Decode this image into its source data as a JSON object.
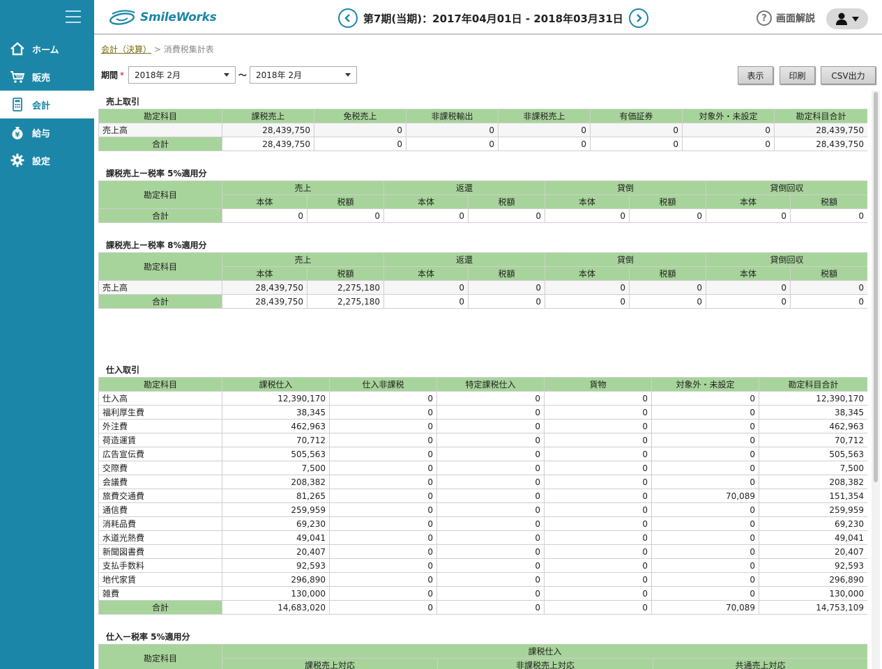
{
  "brand": {
    "name": "SmileWorks",
    "accent": "#1b86a8",
    "header_green": "#a7d49a"
  },
  "nav": [
    {
      "label": "ホーム",
      "icon": "home-icon"
    },
    {
      "label": "販売",
      "icon": "cart-icon"
    },
    {
      "label": "会計",
      "icon": "calculator-icon",
      "active": true
    },
    {
      "label": "給与",
      "icon": "moneybag-icon"
    },
    {
      "label": "設定",
      "icon": "gear-icon"
    }
  ],
  "header": {
    "period": "第7期(当期)：2017年04月01日 - 2018年03月31日",
    "help": "画面解説"
  },
  "breadcrumb": {
    "parent": "会計（決算）",
    "sep": " > ",
    "current": "消費税集計表"
  },
  "filter": {
    "label": "期間",
    "required": "*",
    "from": "2018年 2月",
    "tilde": "〜",
    "to": "2018年 2月"
  },
  "toolbar": {
    "show": "表示",
    "print": "印刷",
    "csv": "CSV出力"
  },
  "sales": {
    "title": "売上取引",
    "headers": [
      "勘定科目",
      "課税売上",
      "免税売上",
      "非課税輸出",
      "非課税売上",
      "有価証券",
      "対象外・未設定",
      "勘定科目合計"
    ],
    "rows": [
      [
        "売上高",
        "28,439,750",
        "0",
        "0",
        "0",
        "0",
        "0",
        "28,439,750"
      ]
    ],
    "total": [
      "合計",
      "28,439,750",
      "0",
      "0",
      "0",
      "0",
      "0",
      "28,439,750"
    ]
  },
  "sales5": {
    "title": "課税売上ー税率 5%適用分",
    "col0": "勘定科目",
    "groups": [
      "売上",
      "返還",
      "貸倒",
      "貸倒回収"
    ],
    "sub": [
      "本体",
      "税額"
    ],
    "rows": [],
    "total": [
      "合計",
      "0",
      "0",
      "0",
      "0",
      "0",
      "0",
      "0",
      "0"
    ]
  },
  "sales8": {
    "title": "課税売上ー税率 8%適用分",
    "col0": "勘定科目",
    "groups": [
      "売上",
      "返還",
      "貸倒",
      "貸倒回収"
    ],
    "sub": [
      "本体",
      "税額"
    ],
    "rows": [
      [
        "売上高",
        "28,439,750",
        "2,275,180",
        "0",
        "0",
        "0",
        "0",
        "0",
        "0"
      ]
    ],
    "total": [
      "合計",
      "28,439,750",
      "2,275,180",
      "0",
      "0",
      "0",
      "0",
      "0",
      "0"
    ]
  },
  "purchase": {
    "title": "仕入取引",
    "headers": [
      "勘定科目",
      "課税仕入",
      "仕入非課税",
      "特定課税仕入",
      "貨物",
      "対象外・未設定",
      "勘定科目合計"
    ],
    "rows": [
      [
        "仕入高",
        "12,390,170",
        "0",
        "0",
        "0",
        "0",
        "12,390,170"
      ],
      [
        "福利厚生費",
        "38,345",
        "0",
        "0",
        "0",
        "0",
        "38,345"
      ],
      [
        "外注費",
        "462,963",
        "0",
        "0",
        "0",
        "0",
        "462,963"
      ],
      [
        "荷造運賃",
        "70,712",
        "0",
        "0",
        "0",
        "0",
        "70,712"
      ],
      [
        "広告宣伝費",
        "505,563",
        "0",
        "0",
        "0",
        "0",
        "505,563"
      ],
      [
        "交際費",
        "7,500",
        "0",
        "0",
        "0",
        "0",
        "7,500"
      ],
      [
        "会議費",
        "208,382",
        "0",
        "0",
        "0",
        "0",
        "208,382"
      ],
      [
        "旅費交通費",
        "81,265",
        "0",
        "0",
        "0",
        "70,089",
        "151,354"
      ],
      [
        "通信費",
        "259,959",
        "0",
        "0",
        "0",
        "0",
        "259,959"
      ],
      [
        "消耗品費",
        "69,230",
        "0",
        "0",
        "0",
        "0",
        "69,230"
      ],
      [
        "水道光熱費",
        "49,041",
        "0",
        "0",
        "0",
        "0",
        "49,041"
      ],
      [
        "新聞図書費",
        "20,407",
        "0",
        "0",
        "0",
        "0",
        "20,407"
      ],
      [
        "支払手数料",
        "92,593",
        "0",
        "0",
        "0",
        "0",
        "92,593"
      ],
      [
        "地代家賃",
        "296,890",
        "0",
        "0",
        "0",
        "0",
        "296,890"
      ],
      [
        "雑費",
        "130,000",
        "0",
        "0",
        "0",
        "0",
        "130,000"
      ]
    ],
    "total": [
      "合計",
      "14,683,020",
      "0",
      "0",
      "0",
      "70,089",
      "14,753,109"
    ]
  },
  "purchase5": {
    "title": "仕入ー税率 5%適用分",
    "col0": "勘定科目",
    "group": "課税仕入",
    "sub": [
      "課税売上対応",
      "非課税売上対応",
      "共通売上対応"
    ]
  }
}
